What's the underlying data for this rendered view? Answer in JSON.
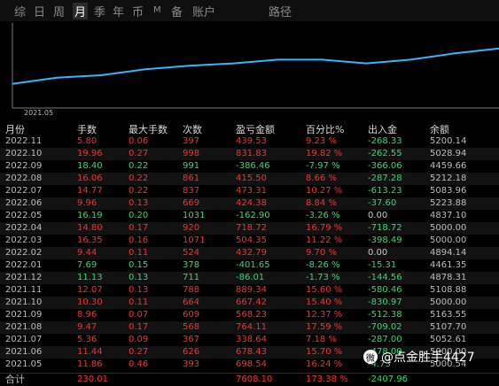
{
  "tabs": [
    {
      "label": "综",
      "active": false
    },
    {
      "label": "日",
      "active": false
    },
    {
      "label": "周",
      "active": false
    },
    {
      "label": "月",
      "active": true
    },
    {
      "label": "季",
      "active": false
    },
    {
      "label": "年",
      "active": false
    },
    {
      "label": "币",
      "active": false
    },
    {
      "label": "M",
      "active": false
    },
    {
      "label": "备",
      "active": false
    },
    {
      "label": "账户",
      "active": false
    },
    {
      "label": "路径",
      "active": false
    }
  ],
  "chart_data": {
    "type": "line",
    "x_axis_label": "2021.05",
    "color": "#2fb8ff",
    "series": [
      {
        "values": [
          4825.41,
          4892.52,
          4917.43,
          4980.0,
          5017.0,
          5042.0,
          5082.0,
          5082.0,
          5042.0,
          5082.0,
          5148.0,
          5200.14
        ]
      }
    ]
  },
  "table": {
    "headers": [
      "月份",
      "手数",
      "最大手数",
      "次数",
      "盈亏金额",
      "百分比%",
      "出入金",
      "余额"
    ],
    "rows": [
      {
        "month": "2022.11",
        "lots": "5.80",
        "max_lots": "0.06",
        "count": "397",
        "pnl": "439.53",
        "pct": "9.23 %",
        "flow": "-268.33",
        "balance": "5200.14",
        "sign": "pos"
      },
      {
        "month": "2022.10",
        "lots": "19.96",
        "max_lots": "0.27",
        "count": "998",
        "pnl": "831.83",
        "pct": "19.82 %",
        "flow": "-262.55",
        "balance": "5028.94",
        "sign": "pos"
      },
      {
        "month": "2022.09",
        "lots": "18.40",
        "max_lots": "0.22",
        "count": "991",
        "pnl": "-386.46",
        "pct": "-7.97 %",
        "flow": "-366.06",
        "balance": "4459.66",
        "sign": "neg"
      },
      {
        "month": "2022.08",
        "lots": "16.06",
        "max_lots": "0.22",
        "count": "861",
        "pnl": "415.50",
        "pct": "8.66 %",
        "flow": "-287.28",
        "balance": "5212.18",
        "sign": "pos"
      },
      {
        "month": "2022.07",
        "lots": "14.77",
        "max_lots": "0.22",
        "count": "837",
        "pnl": "473.31",
        "pct": "10.27 %",
        "flow": "-613.23",
        "balance": "5083.96",
        "sign": "pos"
      },
      {
        "month": "2022.06",
        "lots": "9.96",
        "max_lots": "0.13",
        "count": "669",
        "pnl": "424.38",
        "pct": "8.84 %",
        "flow": "-37.60",
        "balance": "5223.88",
        "sign": "pos"
      },
      {
        "month": "2022.05",
        "lots": "16.19",
        "max_lots": "0.20",
        "count": "1031",
        "pnl": "-162.90",
        "pct": "-3.26 %",
        "flow": "0.00",
        "balance": "4837.10",
        "sign": "neg"
      },
      {
        "month": "2022.04",
        "lots": "14.80",
        "max_lots": "0.17",
        "count": "920",
        "pnl": "718.72",
        "pct": "16.79 %",
        "flow": "-718.72",
        "balance": "5000.00",
        "sign": "pos"
      },
      {
        "month": "2022.03",
        "lots": "16.35",
        "max_lots": "0.16",
        "count": "1071",
        "pnl": "504.35",
        "pct": "11.22 %",
        "flow": "-398.49",
        "balance": "5000.00",
        "sign": "pos"
      },
      {
        "month": "2022.02",
        "lots": "9.44",
        "max_lots": "0.11",
        "count": "524",
        "pnl": "432.79",
        "pct": "9.70 %",
        "flow": "0.00",
        "balance": "4894.14",
        "sign": "pos"
      },
      {
        "month": "2022.01",
        "lots": "7.69",
        "max_lots": "0.15",
        "count": "378",
        "pnl": "-401.65",
        "pct": "-8.26 %",
        "flow": "-15.31",
        "balance": "4461.35",
        "sign": "neg"
      },
      {
        "month": "2021.12",
        "lots": "11.13",
        "max_lots": "0.13",
        "count": "711",
        "pnl": "-86.01",
        "pct": "-1.73 %",
        "flow": "-144.56",
        "balance": "4878.31",
        "sign": "neg"
      },
      {
        "month": "2021.11",
        "lots": "12.07",
        "max_lots": "0.13",
        "count": "788",
        "pnl": "889.34",
        "pct": "15.60 %",
        "flow": "-580.46",
        "balance": "5108.88",
        "sign": "pos"
      },
      {
        "month": "2021.10",
        "lots": "10.30",
        "max_lots": "0.11",
        "count": "664",
        "pnl": "667.42",
        "pct": "15.40 %",
        "flow": "-830.97",
        "balance": "5000.00",
        "sign": "pos"
      },
      {
        "month": "2021.09",
        "lots": "8.96",
        "max_lots": "0.07",
        "count": "609",
        "pnl": "568.23",
        "pct": "12.37 %",
        "flow": "-512.38",
        "balance": "5163.55",
        "sign": "pos"
      },
      {
        "month": "2021.08",
        "lots": "9.47",
        "max_lots": "0.17",
        "count": "568",
        "pnl": "764.11",
        "pct": "17.59 %",
        "flow": "-709.02",
        "balance": "5107.70",
        "sign": "pos"
      },
      {
        "month": "2021.07",
        "lots": "5.36",
        "max_lots": "0.09",
        "count": "367",
        "sign": "pos",
        "pnl": "338.64",
        "pct": "7.18 %",
        "flow": "-287.00",
        "balance": "5052.61"
      },
      {
        "month": "2021.06",
        "lots": "11.44",
        "max_lots": "0.27",
        "count": "626",
        "pnl": "678.43",
        "pct": "15.70 %",
        "flow": "-478.00",
        "balance": "5000.00",
        "sign": "pos"
      },
      {
        "month": "2021.05",
        "lots": "11.86",
        "max_lots": "0.46",
        "count": "393",
        "pnl": "698.54",
        "pct": "16.24 %",
        "flow": "-4.73",
        "balance": "5000.54",
        "sign": "pos"
      }
    ],
    "total": {
      "label": "合计",
      "lots": "230.01",
      "pnl": "7608.10",
      "pct": "173.38 %",
      "flow": "-2407.96"
    }
  },
  "watermark": {
    "icon": "weibo-icon",
    "text": "@点金胜手4427"
  }
}
